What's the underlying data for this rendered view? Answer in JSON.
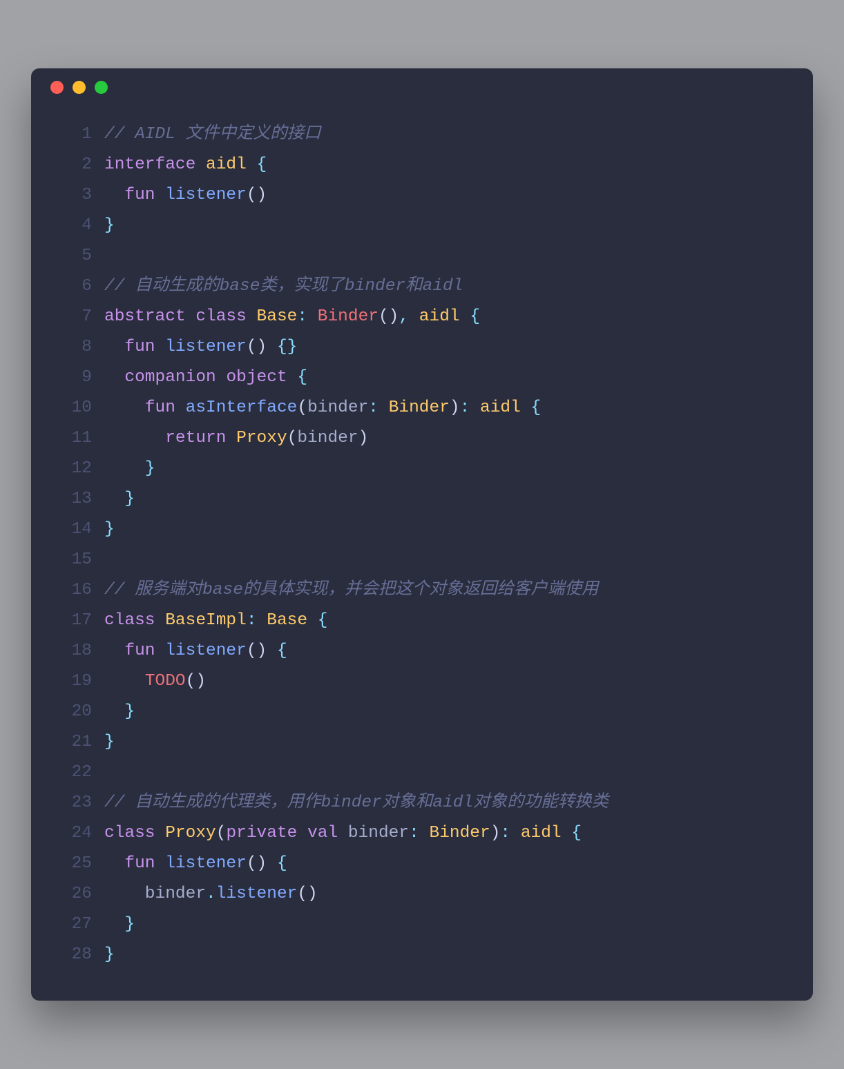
{
  "window": {
    "dots": [
      "red",
      "yellow",
      "green"
    ]
  },
  "colors": {
    "background": "#292d3e",
    "comment": "#676e95",
    "keyword": "#c792ea",
    "class": "#ffcb6b",
    "func": "#82aaff",
    "builtin": "#f07178",
    "punc": "#89ddff",
    "plain": "#a6accd",
    "lineno": "#4c5374"
  },
  "lines": [
    {
      "n": "1",
      "tokens": [
        {
          "c": "c-comment",
          "t": "// AIDL 文件中定义的接口"
        }
      ]
    },
    {
      "n": "2",
      "tokens": [
        {
          "c": "c-keyword",
          "t": "interface"
        },
        {
          "c": "c-plain",
          "t": " "
        },
        {
          "c": "c-class",
          "t": "aidl"
        },
        {
          "c": "c-plain",
          "t": " "
        },
        {
          "c": "c-punc",
          "t": "{"
        }
      ]
    },
    {
      "n": "3",
      "tokens": [
        {
          "c": "c-plain",
          "t": "  "
        },
        {
          "c": "c-keyword",
          "t": "fun"
        },
        {
          "c": "c-plain",
          "t": " "
        },
        {
          "c": "c-func",
          "t": "listener"
        },
        {
          "c": "c-paren",
          "t": "()"
        }
      ]
    },
    {
      "n": "4",
      "tokens": [
        {
          "c": "c-punc",
          "t": "}"
        }
      ]
    },
    {
      "n": "5",
      "tokens": [
        {
          "c": "c-plain",
          "t": ""
        }
      ]
    },
    {
      "n": "6",
      "tokens": [
        {
          "c": "c-comment",
          "t": "// 自动生成的base类，实现了binder和aidl"
        }
      ]
    },
    {
      "n": "7",
      "tokens": [
        {
          "c": "c-keyword",
          "t": "abstract"
        },
        {
          "c": "c-plain",
          "t": " "
        },
        {
          "c": "c-keyword",
          "t": "class"
        },
        {
          "c": "c-plain",
          "t": " "
        },
        {
          "c": "c-class",
          "t": "Base"
        },
        {
          "c": "c-punc",
          "t": ":"
        },
        {
          "c": "c-plain",
          "t": " "
        },
        {
          "c": "c-builtin",
          "t": "Binder"
        },
        {
          "c": "c-paren",
          "t": "()"
        },
        {
          "c": "c-punc",
          "t": ","
        },
        {
          "c": "c-plain",
          "t": " "
        },
        {
          "c": "c-class",
          "t": "aidl"
        },
        {
          "c": "c-plain",
          "t": " "
        },
        {
          "c": "c-punc",
          "t": "{"
        }
      ]
    },
    {
      "n": "8",
      "tokens": [
        {
          "c": "c-plain",
          "t": "  "
        },
        {
          "c": "c-keyword",
          "t": "fun"
        },
        {
          "c": "c-plain",
          "t": " "
        },
        {
          "c": "c-func",
          "t": "listener"
        },
        {
          "c": "c-paren",
          "t": "()"
        },
        {
          "c": "c-plain",
          "t": " "
        },
        {
          "c": "c-punc",
          "t": "{}"
        }
      ]
    },
    {
      "n": "9",
      "tokens": [
        {
          "c": "c-plain",
          "t": "  "
        },
        {
          "c": "c-keyword",
          "t": "companion"
        },
        {
          "c": "c-plain",
          "t": " "
        },
        {
          "c": "c-keyword",
          "t": "object"
        },
        {
          "c": "c-plain",
          "t": " "
        },
        {
          "c": "c-punc",
          "t": "{"
        }
      ]
    },
    {
      "n": "10",
      "tokens": [
        {
          "c": "c-plain",
          "t": "    "
        },
        {
          "c": "c-keyword",
          "t": "fun"
        },
        {
          "c": "c-plain",
          "t": " "
        },
        {
          "c": "c-func",
          "t": "asInterface"
        },
        {
          "c": "c-paren",
          "t": "("
        },
        {
          "c": "c-plain",
          "t": "binder"
        },
        {
          "c": "c-punc",
          "t": ":"
        },
        {
          "c": "c-plain",
          "t": " "
        },
        {
          "c": "c-class",
          "t": "Binder"
        },
        {
          "c": "c-paren",
          "t": ")"
        },
        {
          "c": "c-punc",
          "t": ":"
        },
        {
          "c": "c-plain",
          "t": " "
        },
        {
          "c": "c-class",
          "t": "aidl"
        },
        {
          "c": "c-plain",
          "t": " "
        },
        {
          "c": "c-punc",
          "t": "{"
        }
      ]
    },
    {
      "n": "11",
      "tokens": [
        {
          "c": "c-plain",
          "t": "      "
        },
        {
          "c": "c-keyword",
          "t": "return"
        },
        {
          "c": "c-plain",
          "t": " "
        },
        {
          "c": "c-class",
          "t": "Proxy"
        },
        {
          "c": "c-paren",
          "t": "("
        },
        {
          "c": "c-plain",
          "t": "binder"
        },
        {
          "c": "c-paren",
          "t": ")"
        }
      ]
    },
    {
      "n": "12",
      "tokens": [
        {
          "c": "c-plain",
          "t": "    "
        },
        {
          "c": "c-punc",
          "t": "}"
        }
      ]
    },
    {
      "n": "13",
      "tokens": [
        {
          "c": "c-plain",
          "t": "  "
        },
        {
          "c": "c-punc",
          "t": "}"
        }
      ]
    },
    {
      "n": "14",
      "tokens": [
        {
          "c": "c-punc",
          "t": "}"
        }
      ]
    },
    {
      "n": "15",
      "tokens": [
        {
          "c": "c-plain",
          "t": ""
        }
      ]
    },
    {
      "n": "16",
      "tokens": [
        {
          "c": "c-comment",
          "t": "// 服务端对base的具体实现，并会把这个对象返回给客户端使用"
        }
      ]
    },
    {
      "n": "17",
      "tokens": [
        {
          "c": "c-keyword",
          "t": "class"
        },
        {
          "c": "c-plain",
          "t": " "
        },
        {
          "c": "c-class",
          "t": "BaseImpl"
        },
        {
          "c": "c-punc",
          "t": ":"
        },
        {
          "c": "c-plain",
          "t": " "
        },
        {
          "c": "c-class",
          "t": "Base"
        },
        {
          "c": "c-plain",
          "t": " "
        },
        {
          "c": "c-punc",
          "t": "{"
        }
      ]
    },
    {
      "n": "18",
      "tokens": [
        {
          "c": "c-plain",
          "t": "  "
        },
        {
          "c": "c-keyword",
          "t": "fun"
        },
        {
          "c": "c-plain",
          "t": " "
        },
        {
          "c": "c-func",
          "t": "listener"
        },
        {
          "c": "c-paren",
          "t": "()"
        },
        {
          "c": "c-plain",
          "t": " "
        },
        {
          "c": "c-punc",
          "t": "{"
        }
      ]
    },
    {
      "n": "19",
      "tokens": [
        {
          "c": "c-plain",
          "t": "    "
        },
        {
          "c": "c-builtin",
          "t": "TODO"
        },
        {
          "c": "c-paren",
          "t": "()"
        }
      ]
    },
    {
      "n": "20",
      "tokens": [
        {
          "c": "c-plain",
          "t": "  "
        },
        {
          "c": "c-punc",
          "t": "}"
        }
      ]
    },
    {
      "n": "21",
      "tokens": [
        {
          "c": "c-punc",
          "t": "}"
        }
      ]
    },
    {
      "n": "22",
      "tokens": [
        {
          "c": "c-plain",
          "t": ""
        }
      ]
    },
    {
      "n": "23",
      "tokens": [
        {
          "c": "c-comment",
          "t": "// 自动生成的代理类，用作binder对象和aidl对象的功能转换类"
        }
      ]
    },
    {
      "n": "24",
      "tokens": [
        {
          "c": "c-keyword",
          "t": "class"
        },
        {
          "c": "c-plain",
          "t": " "
        },
        {
          "c": "c-class",
          "t": "Proxy"
        },
        {
          "c": "c-paren",
          "t": "("
        },
        {
          "c": "c-keyword",
          "t": "private"
        },
        {
          "c": "c-plain",
          "t": " "
        },
        {
          "c": "c-keyword",
          "t": "val"
        },
        {
          "c": "c-plain",
          "t": " binder"
        },
        {
          "c": "c-punc",
          "t": ":"
        },
        {
          "c": "c-plain",
          "t": " "
        },
        {
          "c": "c-class",
          "t": "Binder"
        },
        {
          "c": "c-paren",
          "t": ")"
        },
        {
          "c": "c-punc",
          "t": ":"
        },
        {
          "c": "c-plain",
          "t": " "
        },
        {
          "c": "c-class",
          "t": "aidl"
        },
        {
          "c": "c-plain",
          "t": " "
        },
        {
          "c": "c-punc",
          "t": "{"
        }
      ]
    },
    {
      "n": "25",
      "tokens": [
        {
          "c": "c-plain",
          "t": "  "
        },
        {
          "c": "c-keyword",
          "t": "fun"
        },
        {
          "c": "c-plain",
          "t": " "
        },
        {
          "c": "c-func",
          "t": "listener"
        },
        {
          "c": "c-paren",
          "t": "()"
        },
        {
          "c": "c-plain",
          "t": " "
        },
        {
          "c": "c-punc",
          "t": "{"
        }
      ]
    },
    {
      "n": "26",
      "tokens": [
        {
          "c": "c-plain",
          "t": "    binder"
        },
        {
          "c": "c-punc",
          "t": "."
        },
        {
          "c": "c-func",
          "t": "listener"
        },
        {
          "c": "c-paren",
          "t": "()"
        }
      ]
    },
    {
      "n": "27",
      "tokens": [
        {
          "c": "c-plain",
          "t": "  "
        },
        {
          "c": "c-punc",
          "t": "}"
        }
      ]
    },
    {
      "n": "28",
      "tokens": [
        {
          "c": "c-punc",
          "t": "}"
        }
      ]
    }
  ]
}
